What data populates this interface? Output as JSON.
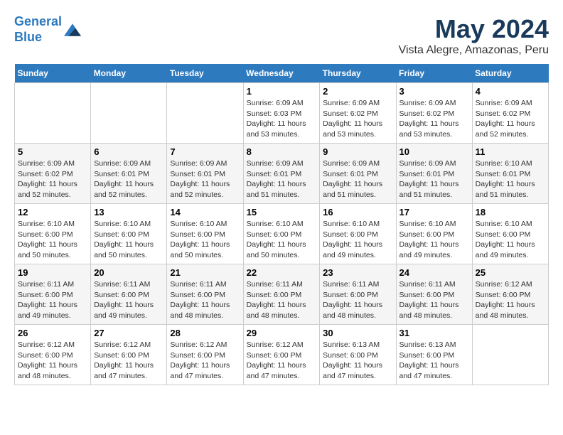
{
  "header": {
    "logo_line1": "General",
    "logo_line2": "Blue",
    "month": "May 2024",
    "location": "Vista Alegre, Amazonas, Peru"
  },
  "weekdays": [
    "Sunday",
    "Monday",
    "Tuesday",
    "Wednesday",
    "Thursday",
    "Friday",
    "Saturday"
  ],
  "weeks": [
    [
      {
        "day": "",
        "info": ""
      },
      {
        "day": "",
        "info": ""
      },
      {
        "day": "",
        "info": ""
      },
      {
        "day": "1",
        "info": "Sunrise: 6:09 AM\nSunset: 6:03 PM\nDaylight: 11 hours and 53 minutes."
      },
      {
        "day": "2",
        "info": "Sunrise: 6:09 AM\nSunset: 6:02 PM\nDaylight: 11 hours and 53 minutes."
      },
      {
        "day": "3",
        "info": "Sunrise: 6:09 AM\nSunset: 6:02 PM\nDaylight: 11 hours and 53 minutes."
      },
      {
        "day": "4",
        "info": "Sunrise: 6:09 AM\nSunset: 6:02 PM\nDaylight: 11 hours and 52 minutes."
      }
    ],
    [
      {
        "day": "5",
        "info": "Sunrise: 6:09 AM\nSunset: 6:02 PM\nDaylight: 11 hours and 52 minutes."
      },
      {
        "day": "6",
        "info": "Sunrise: 6:09 AM\nSunset: 6:01 PM\nDaylight: 11 hours and 52 minutes."
      },
      {
        "day": "7",
        "info": "Sunrise: 6:09 AM\nSunset: 6:01 PM\nDaylight: 11 hours and 52 minutes."
      },
      {
        "day": "8",
        "info": "Sunrise: 6:09 AM\nSunset: 6:01 PM\nDaylight: 11 hours and 51 minutes."
      },
      {
        "day": "9",
        "info": "Sunrise: 6:09 AM\nSunset: 6:01 PM\nDaylight: 11 hours and 51 minutes."
      },
      {
        "day": "10",
        "info": "Sunrise: 6:09 AM\nSunset: 6:01 PM\nDaylight: 11 hours and 51 minutes."
      },
      {
        "day": "11",
        "info": "Sunrise: 6:10 AM\nSunset: 6:01 PM\nDaylight: 11 hours and 51 minutes."
      }
    ],
    [
      {
        "day": "12",
        "info": "Sunrise: 6:10 AM\nSunset: 6:00 PM\nDaylight: 11 hours and 50 minutes."
      },
      {
        "day": "13",
        "info": "Sunrise: 6:10 AM\nSunset: 6:00 PM\nDaylight: 11 hours and 50 minutes."
      },
      {
        "day": "14",
        "info": "Sunrise: 6:10 AM\nSunset: 6:00 PM\nDaylight: 11 hours and 50 minutes."
      },
      {
        "day": "15",
        "info": "Sunrise: 6:10 AM\nSunset: 6:00 PM\nDaylight: 11 hours and 50 minutes."
      },
      {
        "day": "16",
        "info": "Sunrise: 6:10 AM\nSunset: 6:00 PM\nDaylight: 11 hours and 49 minutes."
      },
      {
        "day": "17",
        "info": "Sunrise: 6:10 AM\nSunset: 6:00 PM\nDaylight: 11 hours and 49 minutes."
      },
      {
        "day": "18",
        "info": "Sunrise: 6:10 AM\nSunset: 6:00 PM\nDaylight: 11 hours and 49 minutes."
      }
    ],
    [
      {
        "day": "19",
        "info": "Sunrise: 6:11 AM\nSunset: 6:00 PM\nDaylight: 11 hours and 49 minutes."
      },
      {
        "day": "20",
        "info": "Sunrise: 6:11 AM\nSunset: 6:00 PM\nDaylight: 11 hours and 49 minutes."
      },
      {
        "day": "21",
        "info": "Sunrise: 6:11 AM\nSunset: 6:00 PM\nDaylight: 11 hours and 48 minutes."
      },
      {
        "day": "22",
        "info": "Sunrise: 6:11 AM\nSunset: 6:00 PM\nDaylight: 11 hours and 48 minutes."
      },
      {
        "day": "23",
        "info": "Sunrise: 6:11 AM\nSunset: 6:00 PM\nDaylight: 11 hours and 48 minutes."
      },
      {
        "day": "24",
        "info": "Sunrise: 6:11 AM\nSunset: 6:00 PM\nDaylight: 11 hours and 48 minutes."
      },
      {
        "day": "25",
        "info": "Sunrise: 6:12 AM\nSunset: 6:00 PM\nDaylight: 11 hours and 48 minutes."
      }
    ],
    [
      {
        "day": "26",
        "info": "Sunrise: 6:12 AM\nSunset: 6:00 PM\nDaylight: 11 hours and 48 minutes."
      },
      {
        "day": "27",
        "info": "Sunrise: 6:12 AM\nSunset: 6:00 PM\nDaylight: 11 hours and 47 minutes."
      },
      {
        "day": "28",
        "info": "Sunrise: 6:12 AM\nSunset: 6:00 PM\nDaylight: 11 hours and 47 minutes."
      },
      {
        "day": "29",
        "info": "Sunrise: 6:12 AM\nSunset: 6:00 PM\nDaylight: 11 hours and 47 minutes."
      },
      {
        "day": "30",
        "info": "Sunrise: 6:13 AM\nSunset: 6:00 PM\nDaylight: 11 hours and 47 minutes."
      },
      {
        "day": "31",
        "info": "Sunrise: 6:13 AM\nSunset: 6:00 PM\nDaylight: 11 hours and 47 minutes."
      },
      {
        "day": "",
        "info": ""
      }
    ]
  ]
}
